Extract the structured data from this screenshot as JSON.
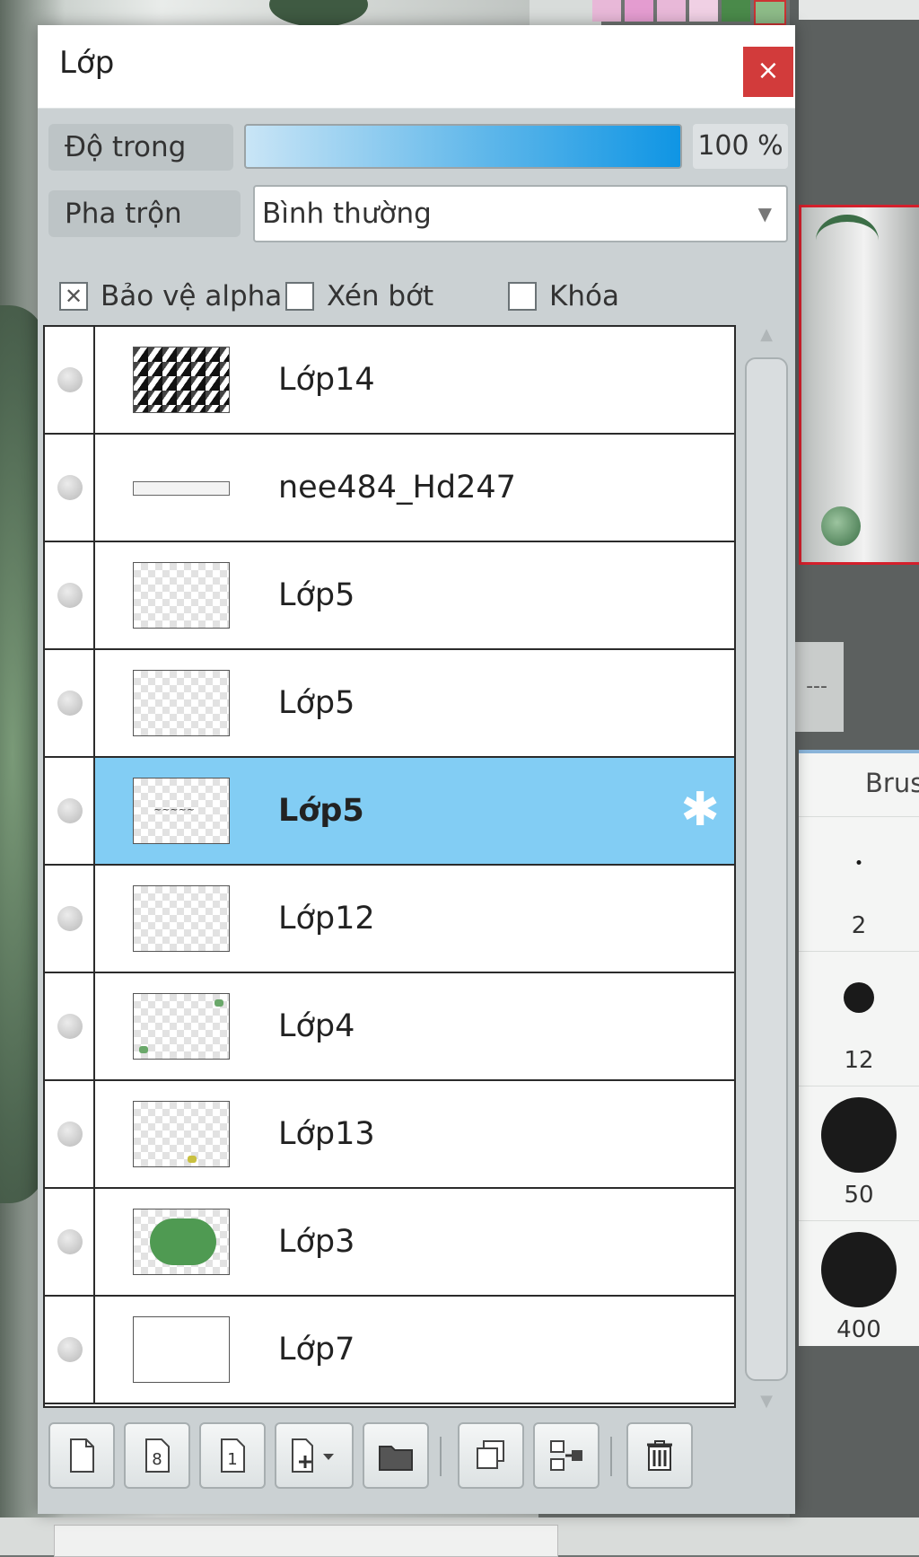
{
  "window": {
    "title": "Lớp",
    "close_label": "×"
  },
  "controls": {
    "opacity_label": "Độ trong",
    "opacity_value": "100 %",
    "opacity_fraction": 1.0,
    "blend_label": "Pha trộn",
    "blend_value": "Bình thường"
  },
  "options": [
    {
      "label": "Bảo vệ alpha",
      "checked": true
    },
    {
      "label": "Xén bớt",
      "checked": false
    },
    {
      "label": "Khóa",
      "checked": false
    }
  ],
  "layers": [
    {
      "name": "Lớp14",
      "thumb": "stripes",
      "selected": false
    },
    {
      "name": "nee484_Hd247",
      "thumb": "line",
      "selected": false
    },
    {
      "name": "Lớp5",
      "thumb": "transparent",
      "selected": false
    },
    {
      "name": "Lớp5",
      "thumb": "transparent",
      "selected": false
    },
    {
      "name": "Lớp5",
      "thumb": "script",
      "selected": true
    },
    {
      "name": "Lớp12",
      "thumb": "transparent",
      "selected": false
    },
    {
      "name": "Lớp4",
      "thumb": "corners",
      "selected": false
    },
    {
      "name": "Lớp13",
      "thumb": "bottom-mark",
      "selected": false
    },
    {
      "name": "Lớp3",
      "thumb": "green",
      "selected": false
    },
    {
      "name": "Lớp7",
      "thumb": "white",
      "selected": false
    }
  ],
  "toolbar": [
    {
      "name": "new-layer-button",
      "icon": "page-icon"
    },
    {
      "name": "new-8bit-layer-button",
      "icon": "page-8-icon"
    },
    {
      "name": "new-1bit-layer-button",
      "icon": "page-1-icon"
    },
    {
      "name": "add-layer-menu-button",
      "icon": "page-plus-dropdown-icon"
    },
    {
      "name": "new-folder-button",
      "icon": "folder-icon"
    },
    {
      "name": "duplicate-layer-button",
      "icon": "duplicate-icon"
    },
    {
      "name": "merge-down-button",
      "icon": "merge-icon"
    },
    {
      "name": "delete-layer-button",
      "icon": "trash-icon"
    }
  ],
  "brush_panel": {
    "title": "Brus",
    "sizes": [
      "2",
      "12",
      "50",
      "400"
    ]
  },
  "colors": {
    "selected_row": "#82cdf4",
    "close_button": "#d23b3b",
    "opacity_bar_end": "#0f95e4"
  }
}
